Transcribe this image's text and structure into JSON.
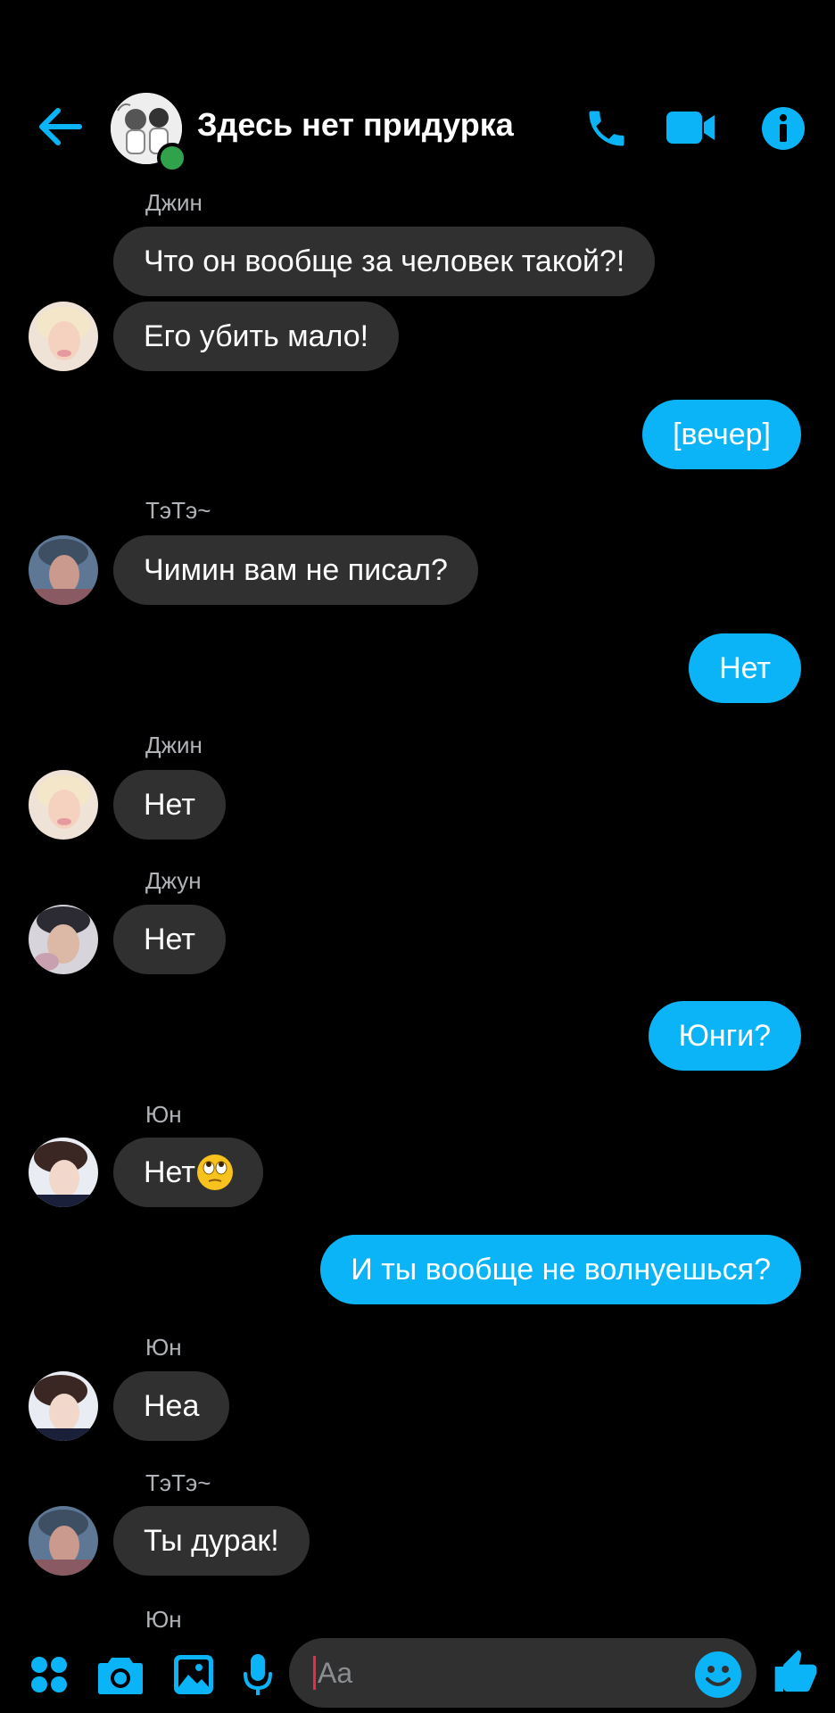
{
  "header": {
    "title": "Здесь нет придурка",
    "icons": [
      "back-arrow-icon",
      "phone-icon",
      "video-camera-icon",
      "info-icon"
    ],
    "accent": "#0bb4f6",
    "online_color": "#31a24c"
  },
  "messages": {
    "m1_sender": "Джин",
    "m1_text": "Что он вообще за человек такой?!",
    "m2_text": "Его убить мало!",
    "m3_text": "[вечер]",
    "m4_sender": "ТэТэ~",
    "m4_text": "Чимин вам не писал?",
    "m5_text": "Нет",
    "m6_sender": "Джин",
    "m6_text": "Нет",
    "m7_sender": "Джун",
    "m7_text": "Нет",
    "m8_text": "Юнги?",
    "m9_sender": "Юн",
    "m9_text": "Нет",
    "m9_emoji": "face-with-rolling-eyes",
    "m10_text": "И ты вообще не волнуешься?",
    "m11_sender": "Юн",
    "m11_text": "Неа",
    "m12_sender": "ТэТэ~",
    "m12_text": "Ты дурак!",
    "m13_sender": "Юн"
  },
  "composer": {
    "placeholder": "Aa",
    "icons": [
      "apps-grid-icon",
      "camera-icon",
      "gallery-icon",
      "microphone-icon",
      "emoji-icon",
      "thumbs-up-icon"
    ]
  },
  "colors": {
    "background": "#000000",
    "incoming_bubble": "#303030",
    "outgoing_bubble": "#0bb4f6",
    "sender_label": "#b0b3b8"
  }
}
